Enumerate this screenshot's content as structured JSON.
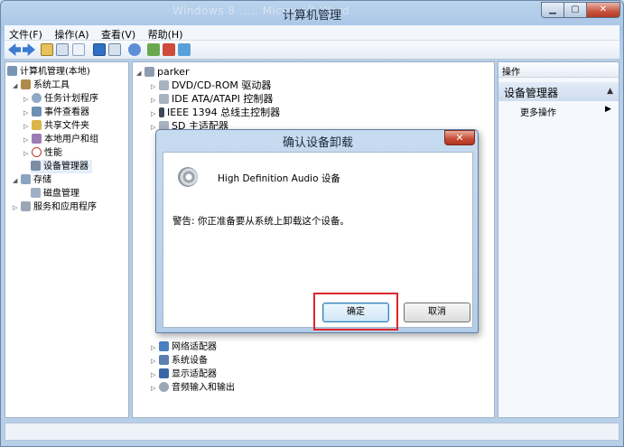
{
  "window": {
    "title": "计算机管理",
    "ghost_title": "Windows 8 ..... Microsoft Word",
    "minimize": "▁",
    "maximize": "▢",
    "close": "✕"
  },
  "menubar": [
    "文件(F)",
    "操作(A)",
    "查看(V)",
    "帮助(H)"
  ],
  "left_tree": {
    "root": "计算机管理(本地)",
    "system_tools": "系统工具",
    "task_scheduler": "任务计划程序",
    "event_viewer": "事件查看器",
    "shared_folders": "共享文件夹",
    "local_users": "本地用户和组",
    "performance": "性能",
    "device_manager": "设备管理器",
    "storage": "存储",
    "disk_management": "磁盘管理",
    "services_apps": "服务和应用程序"
  },
  "device_tree": {
    "computer": "parker",
    "dvd": "DVD/CD-ROM 驱动器",
    "ide": "IDE ATA/ATAPI 控制器",
    "ieee1394": "IEEE 1394 总线主控制器",
    "sd": "SD 主适配器",
    "network": "网络适配器",
    "system": "系统设备",
    "display": "显示适配器",
    "audio_io": "音频输入和输出"
  },
  "actions": {
    "header": "操作",
    "section": "设备管理器",
    "more": "更多操作"
  },
  "dialog": {
    "title": "确认设备卸载",
    "device_name": "High Definition Audio 设备",
    "warning": "警告: 你正准备要从系统上卸载这个设备。",
    "ok": "确定",
    "cancel": "取消",
    "highlight_color": "#e0262a"
  },
  "colors": {
    "accent": "#3c7fb1",
    "close_red": "#c74a32"
  }
}
